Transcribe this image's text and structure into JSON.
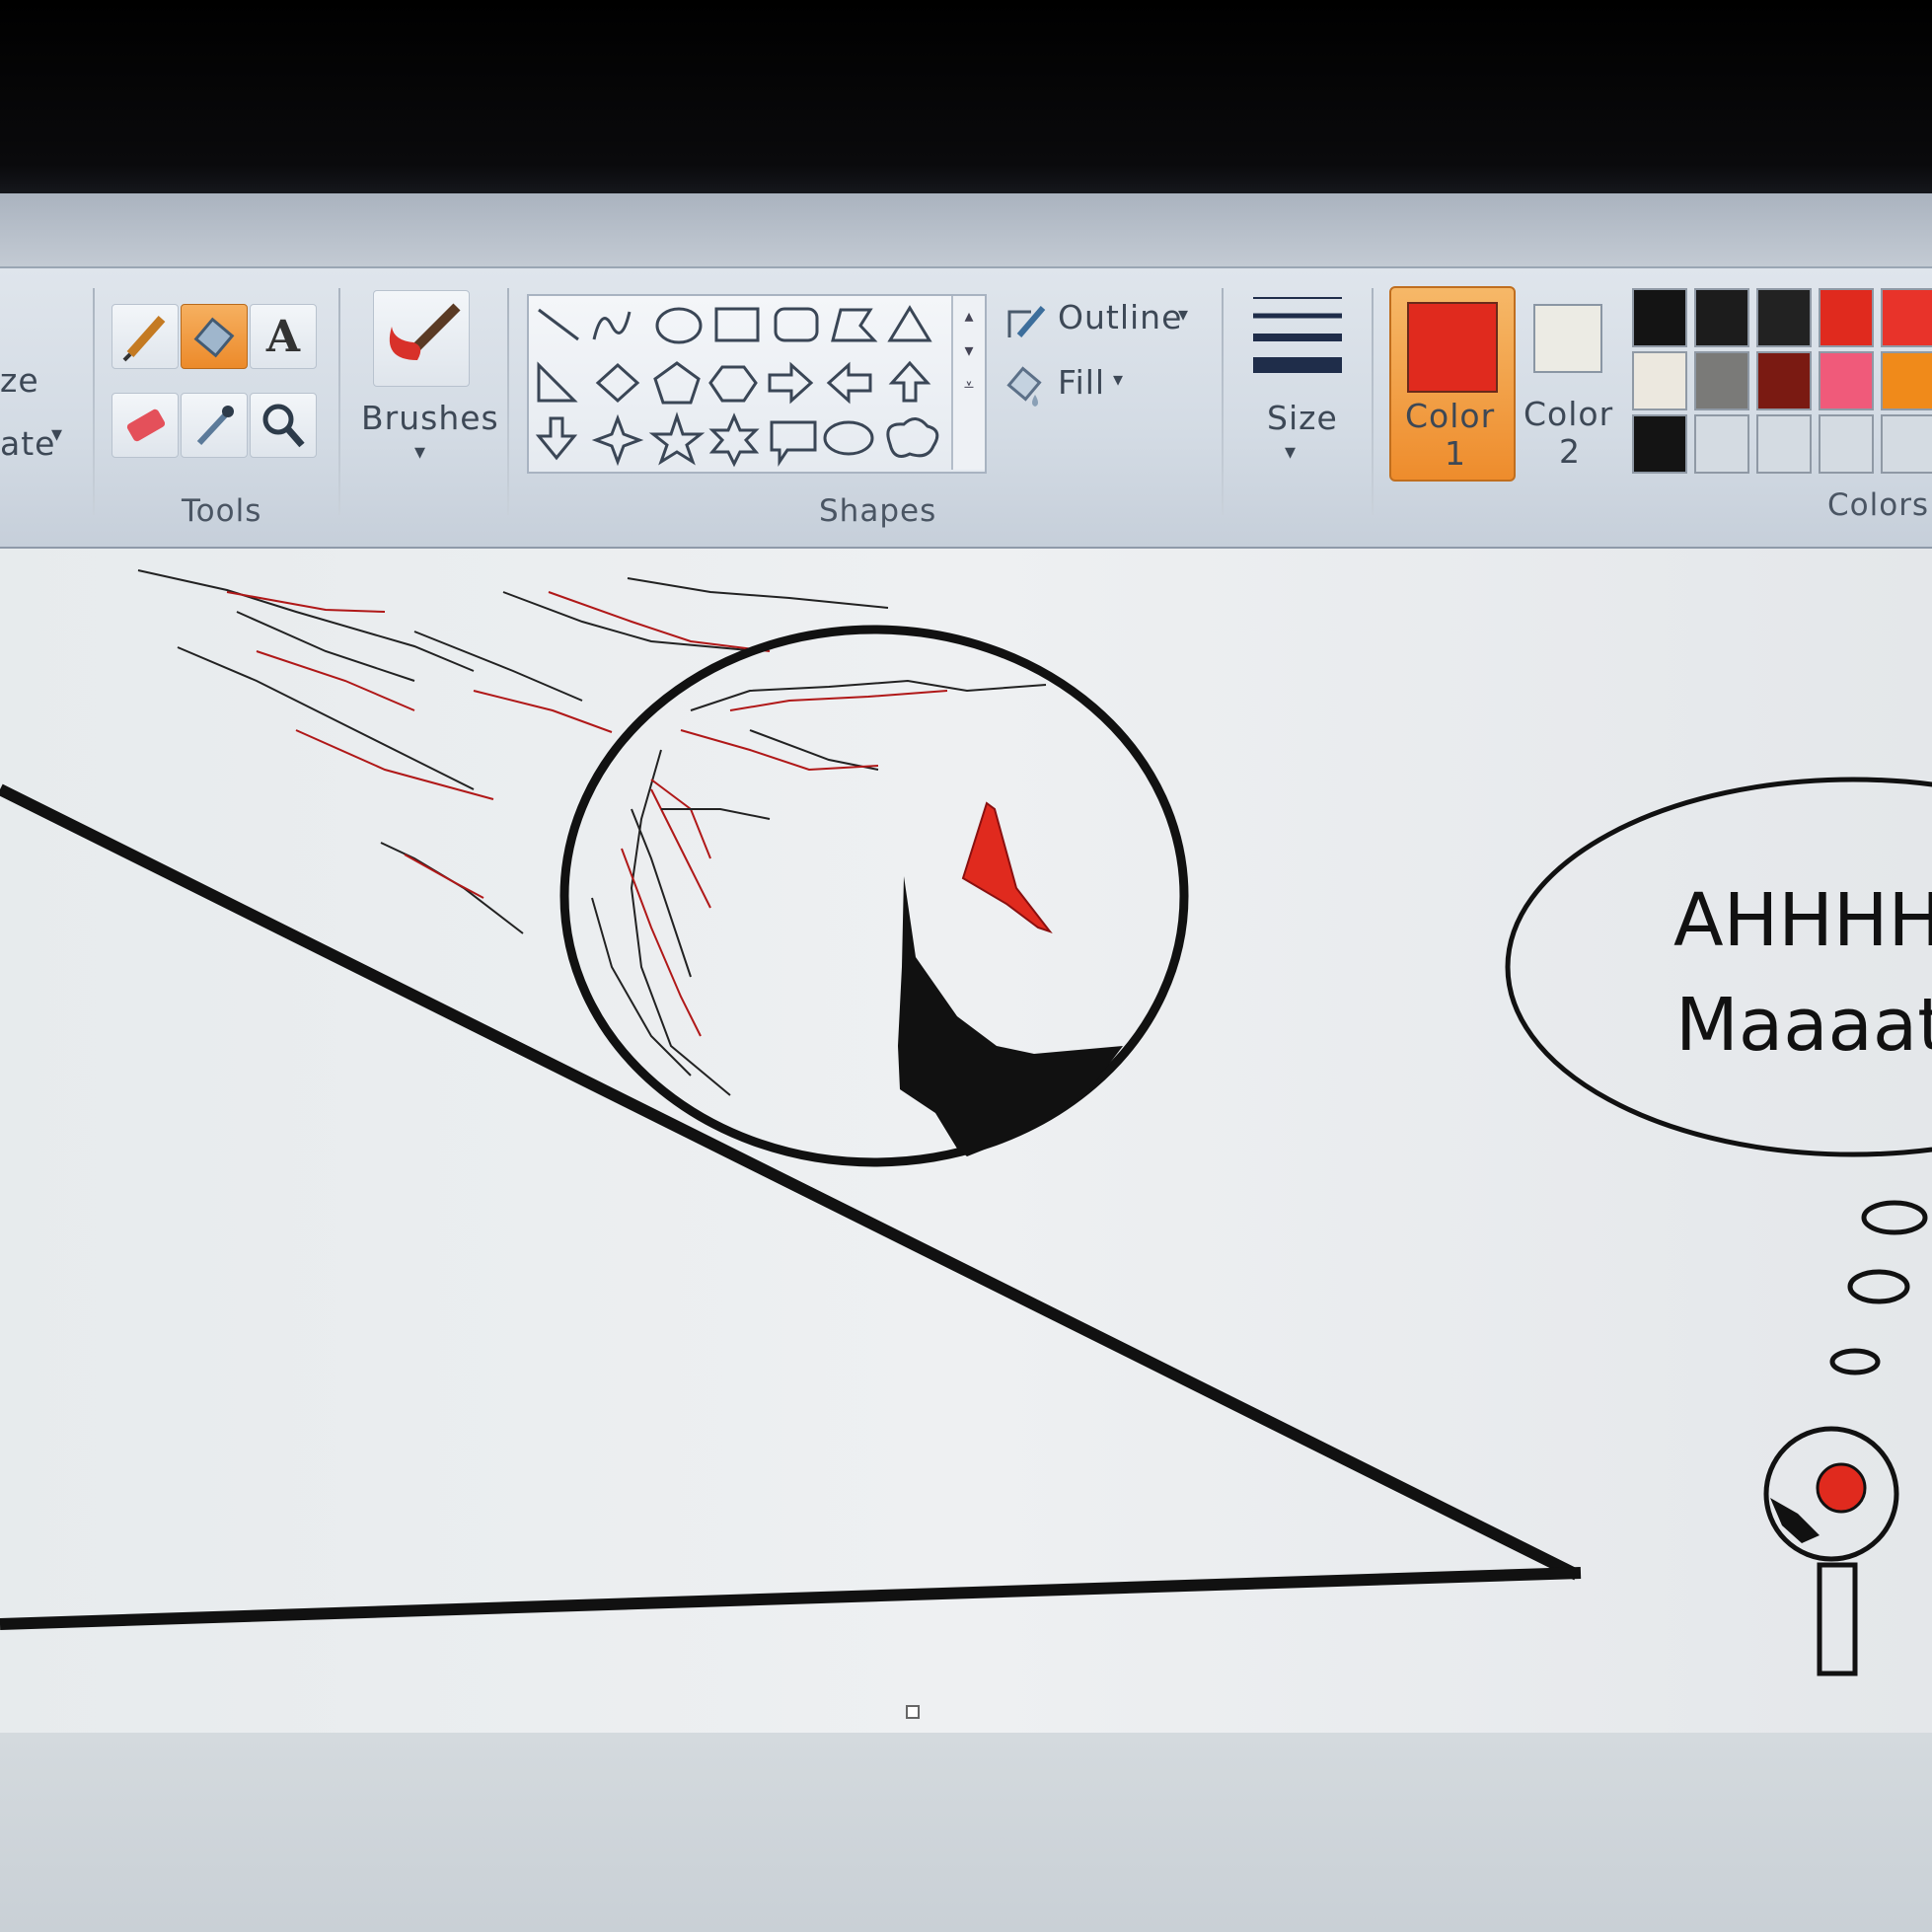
{
  "ribbon": {
    "left_partial": {
      "line1": "ze",
      "line2": "ate"
    },
    "tools": {
      "label": "Tools",
      "text_tool_glyph": "A"
    },
    "brushes": {
      "label": "Brushes"
    },
    "shapes": {
      "label": "Shapes"
    },
    "outline": {
      "label": "Outline"
    },
    "fill": {
      "label": "Fill"
    },
    "size": {
      "label": "Size"
    },
    "color1": {
      "label": "Color",
      "number": "1",
      "value": "#e02a1e"
    },
    "color2": {
      "label": "Color",
      "number": "2",
      "value": "#ecebe4"
    },
    "colors": {
      "label": "Colors"
    },
    "palette": [
      "#141414",
      "#1c1c1c",
      "#222222",
      "#e02a1e",
      "#e8332a",
      "#ece8df",
      "#7a7a78",
      "#7a1a12",
      "#f05a7a",
      "#f08a1a",
      "#141414",
      "#d4dbe2",
      "#d4dbe2",
      "#d4dbe2",
      "#d4dbe2"
    ]
  },
  "canvas": {
    "speech_line1": "AHHHH",
    "speech_line2": "Maaaat",
    "accent_red": "#e02a1e"
  }
}
